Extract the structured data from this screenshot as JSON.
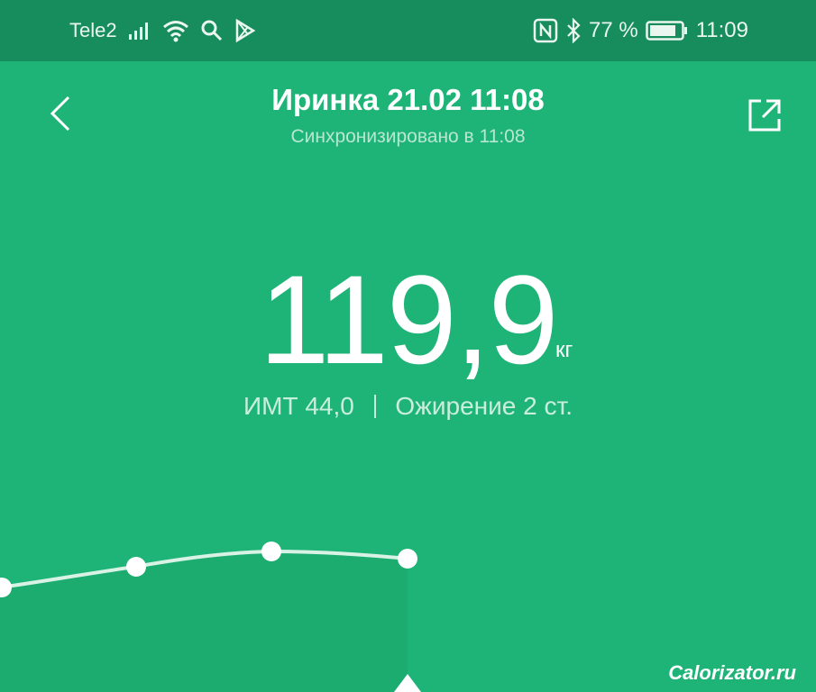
{
  "status_bar": {
    "carrier": "Tele2",
    "battery_text": "77 %",
    "time": "11:09",
    "icons": [
      "signal-icon",
      "wifi-icon",
      "search-icon",
      "play-store-icon",
      "nfc-icon",
      "bluetooth-icon",
      "battery-icon"
    ]
  },
  "header": {
    "title": "Иринка 21.02 11:08",
    "subtitle": "Синхронизировано в 11:08",
    "back_icon": "chevron-left-icon",
    "share_icon": "share-icon"
  },
  "measurement": {
    "weight": "119,9",
    "unit": "кг",
    "bmi_label": "ИМТ 44,0",
    "bmi_category": "Ожирение 2 ст."
  },
  "chart_data": {
    "type": "line",
    "series": [
      {
        "values": [
          null,
          null,
          null,
          null
        ]
      }
    ]
  },
  "watermark": "Calorizator.ru",
  "colors": {
    "background": "#1fb477",
    "status_bar": "#178c5c",
    "text": "#ffffff"
  }
}
